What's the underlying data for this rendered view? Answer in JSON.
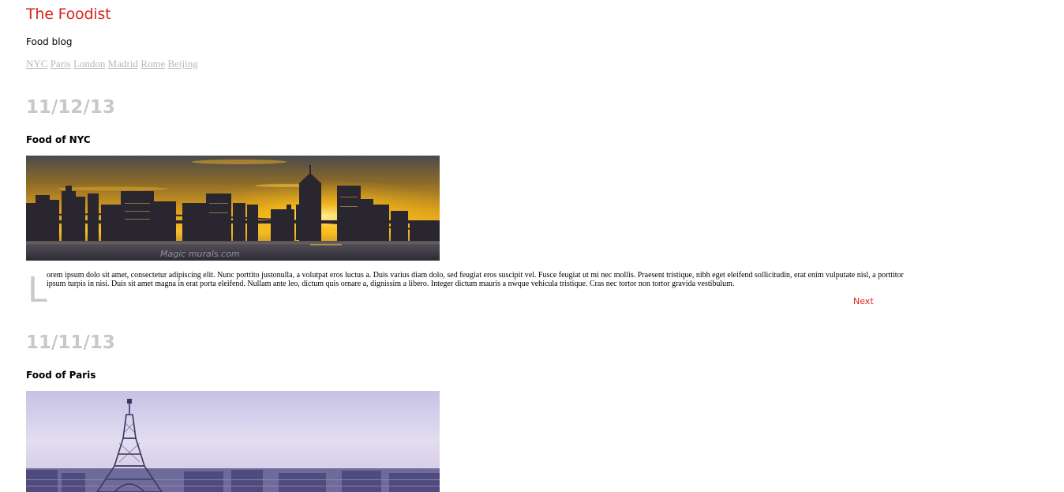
{
  "site": {
    "title": "The Foodist",
    "tagline": "Food blog"
  },
  "nav": {
    "items": [
      "NYC",
      "Paris",
      "London",
      "Madrid",
      "Rome",
      "Beijing"
    ]
  },
  "posts": [
    {
      "date": "11/12/13",
      "title": "Food of NYC",
      "image_icon": "nyc-skyline-image",
      "image_watermark": "Magic murals.com",
      "dropcap": "L",
      "body": "orem ipsum dolo sit amet, consectetur adipiscing elit. Nunc porttito justonulla, a volutpat eros luctus a. Duis varius diam dolo, sed feugiat eros suscipit vel. Fusce feugiat ut mi nec mollis. Praesent tristique, nibh eget eleifend sollicitudin, erat enim vulputate nisl, a porttitor ipsum turpis in nisi. Duis sit amet magna in erat porta eleifend. Nullam ante leo, dictum quis ornare a, dignissim a libero. Integer dictum mauris a nwque vehicula tristique. Cras nec tortor non tortor gravida vestibulum.",
      "next_label": "Next"
    },
    {
      "date": "11/11/13",
      "title": "Food of Paris",
      "image_icon": "paris-eiffel-tower-image"
    }
  ],
  "colors": {
    "accent": "#d9251d",
    "date": "#c8c8c8",
    "nav_link": "#b8b8b8"
  }
}
